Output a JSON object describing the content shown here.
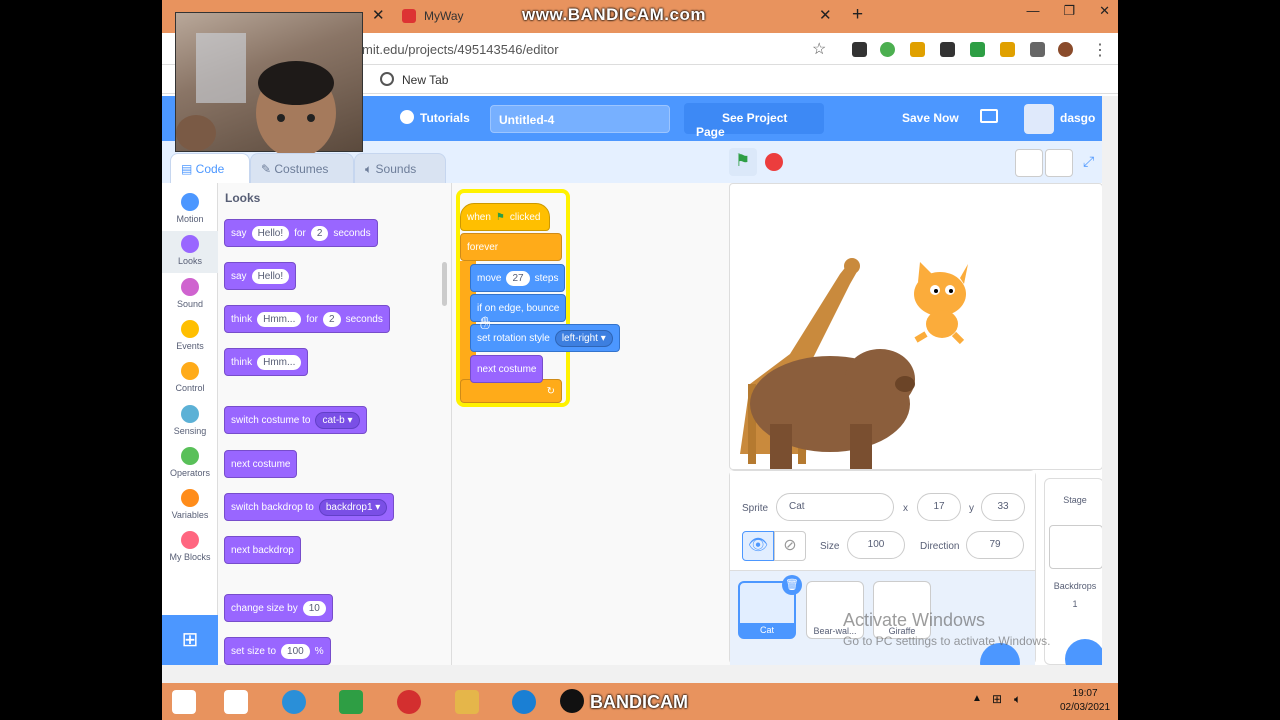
{
  "browser": {
    "tab_active_title": "MyWay",
    "watermark": "www.BANDICAM.com",
    "url": "mit.edu/projects/495143546/editor",
    "bookmark_label": "New Tab"
  },
  "menu": {
    "tutorials": "Tutorials",
    "project_title": "Untitled-4",
    "see_project": "See Project Page",
    "save_now": "Save Now",
    "username": "dasgo"
  },
  "tabs": {
    "code": "Code",
    "costumes": "Costumes",
    "sounds": "Sounds"
  },
  "categories": [
    {
      "label": "Motion",
      "color": "#4c97ff"
    },
    {
      "label": "Looks",
      "color": "#9966ff"
    },
    {
      "label": "Sound",
      "color": "#cf63cf"
    },
    {
      "label": "Events",
      "color": "#ffbf00"
    },
    {
      "label": "Control",
      "color": "#ffab19"
    },
    {
      "label": "Sensing",
      "color": "#5cb1d6"
    },
    {
      "label": "Operators",
      "color": "#59c059"
    },
    {
      "label": "Variables",
      "color": "#ff8c1a"
    },
    {
      "label": "My Blocks",
      "color": "#ff6680"
    }
  ],
  "palette": {
    "title": "Looks",
    "say_for": {
      "say": "say",
      "msg": "Hello!",
      "for": "for",
      "secs": "2",
      "seconds": "seconds"
    },
    "say": {
      "say": "say",
      "msg": "Hello!"
    },
    "think_for": {
      "think": "think",
      "msg": "Hmm...",
      "for": "for",
      "secs": "2",
      "seconds": "seconds"
    },
    "think": {
      "think": "think",
      "msg": "Hmm..."
    },
    "switch_costume": {
      "text": "switch costume to",
      "value": "cat-b"
    },
    "next_costume": "next costume",
    "switch_backdrop": {
      "text": "switch backdrop to",
      "value": "backdrop1"
    },
    "next_backdrop": "next backdrop",
    "change_size": {
      "text": "change size by",
      "value": "10"
    },
    "set_size": {
      "text": "set size to",
      "value": "100",
      "unit": "%"
    }
  },
  "script": {
    "when": "when",
    "clicked": "clicked",
    "forever": "forever",
    "move": "move",
    "steps_value": "27",
    "steps": "steps",
    "bounce": "if on edge, bounce",
    "rotation": "set rotation style",
    "rotation_value": "left-right",
    "next_costume": "next costume"
  },
  "sprite_info": {
    "sprite_label": "Sprite",
    "sprite_name": "Cat",
    "x_label": "x",
    "x": "17",
    "y_label": "y",
    "y": "33",
    "size_label": "Size",
    "size": "100",
    "direction_label": "Direction",
    "direction": "79"
  },
  "sprites": [
    "Cat",
    "Bear-wal...",
    "Giraffe"
  ],
  "stage_pane": {
    "title": "Stage",
    "backdrops_label": "Backdrops",
    "backdrops_count": "1"
  },
  "activate": {
    "line1": "Activate Windows",
    "line2": "Go to PC settings to activate Windows."
  },
  "taskbar": {
    "app": "BANDICAM",
    "time": "19:07",
    "date": "02/03/2021"
  }
}
